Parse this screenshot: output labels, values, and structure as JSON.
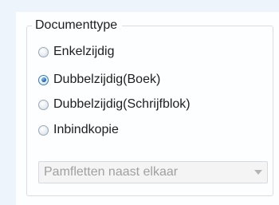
{
  "group": {
    "title": "Documenttype"
  },
  "options": [
    {
      "label": "Enkelzijdig",
      "checked": false
    },
    {
      "label": "Dubbelzijdig(Boek)",
      "checked": true
    },
    {
      "label": "Dubbelzijdig(Schrijfblok)",
      "checked": false
    },
    {
      "label": "Inbindkopie",
      "checked": false
    }
  ],
  "combo": {
    "value": "Pamfletten naast elkaar",
    "enabled": false,
    "arrow_icon": "chevron-down-icon"
  },
  "colors": {
    "background": "#eef4fb",
    "panel": "#fdfeff",
    "group_border": "#d5dfe5",
    "selected_radio": "#2a6ab0",
    "disabled_text": "#a0a0a0"
  }
}
